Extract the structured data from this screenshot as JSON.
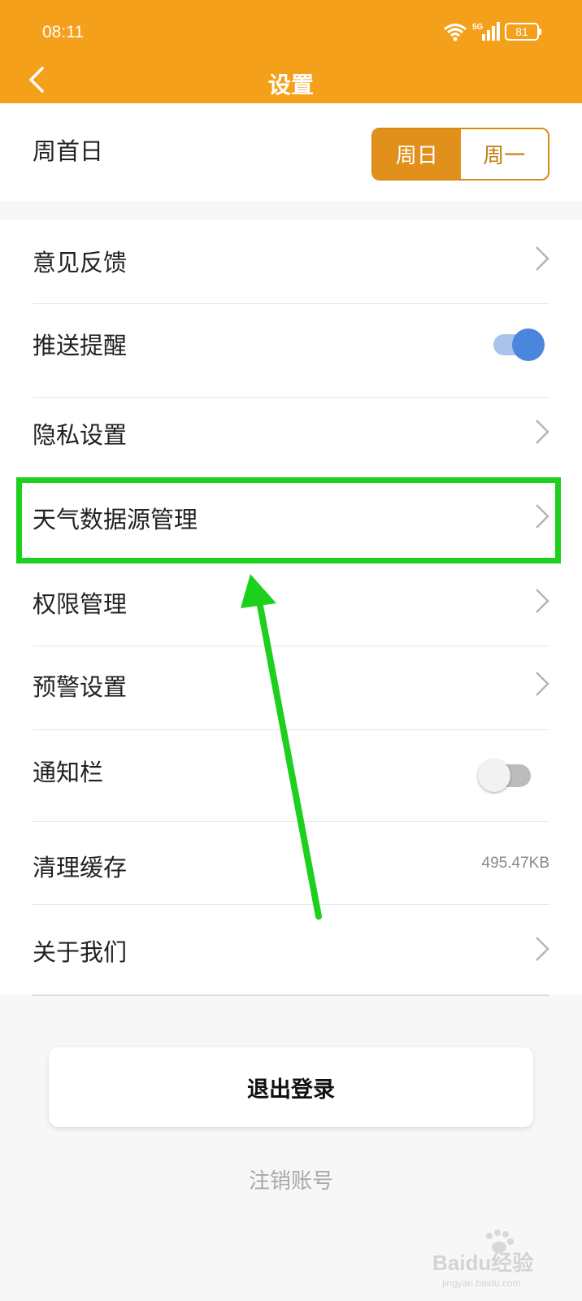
{
  "status_bar": {
    "time": "08:11",
    "network": "5G",
    "battery": "81"
  },
  "header": {
    "title": "设置"
  },
  "week_start": {
    "label": "周首日",
    "options": [
      "周日",
      "周一"
    ],
    "selected": "周日"
  },
  "settings": {
    "items": [
      {
        "label": "意见反馈",
        "control": "chevron"
      },
      {
        "label": "推送提醒",
        "control": "toggle",
        "value": "on"
      },
      {
        "label": "隐私设置",
        "control": "chevron"
      },
      {
        "label": "天气数据源管理",
        "control": "chevron"
      },
      {
        "label": "权限管理",
        "control": "chevron"
      },
      {
        "label": "预警设置",
        "control": "chevron"
      },
      {
        "label": "通知栏",
        "control": "toggle",
        "value": "off"
      },
      {
        "label": "清理缓存",
        "control": "value",
        "value": "495.47KB"
      },
      {
        "label": "关于我们",
        "control": "chevron"
      }
    ]
  },
  "actions": {
    "logout": "退出登录",
    "cancel_account": "注销账号"
  },
  "watermark": {
    "text": "Baidu经验",
    "url": "jingyan.baidu.com"
  },
  "colors": {
    "header": "#f5a01a",
    "segment_active": "#e2901c",
    "toggle_on": "#4a86db",
    "highlight": "#1ed01e",
    "annotation_arrow": "#1ed01e"
  }
}
